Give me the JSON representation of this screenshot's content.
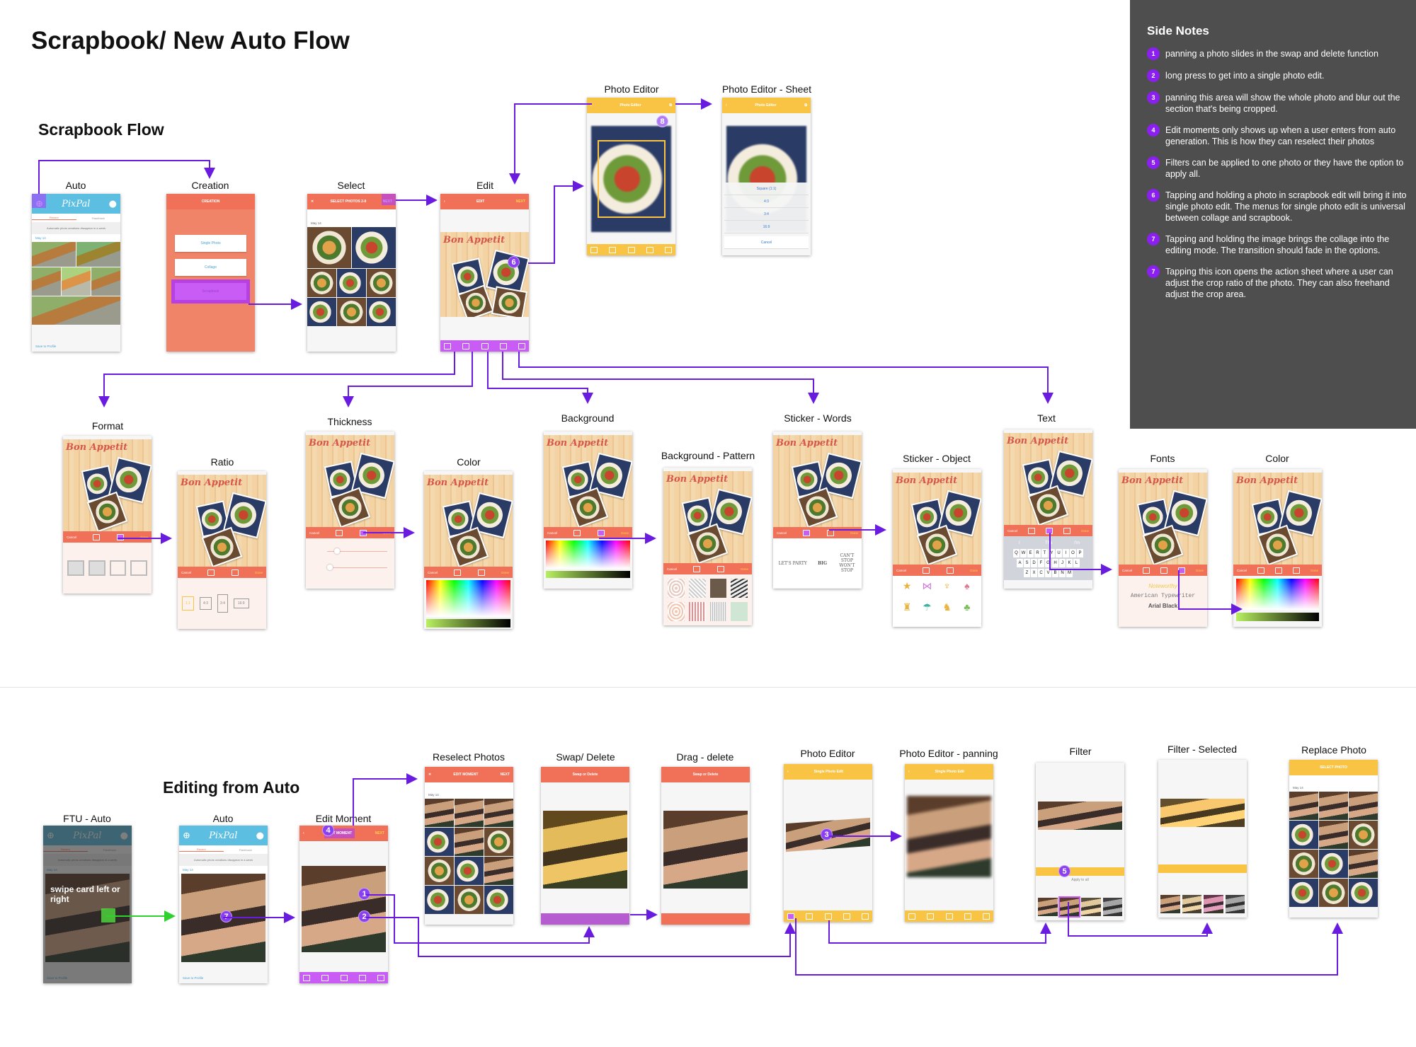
{
  "title": "Scrapbook/ New Auto Flow",
  "section_scrapbook": "Scrapbook Flow",
  "section_editing": "Editing from Auto",
  "side_notes": {
    "title": "Side Notes",
    "items": [
      {
        "num": "1",
        "text": "panning a photo slides in the swap and delete function"
      },
      {
        "num": "2",
        "text": "long press to get into a single photo edit."
      },
      {
        "num": "3",
        "text": "panning this area will show the whole photo and blur out the section that's being cropped."
      },
      {
        "num": "4",
        "text": "Edit moments only shows up when a user enters from auto generation. This is how they can reselect their photos"
      },
      {
        "num": "5",
        "text": "Filters can be applied to one photo or they have the option to apply all."
      },
      {
        "num": "6",
        "text": "Tapping and holding  a photo in scrapbook edit will bring it into single photo edit. The menus for single photo edit is universal between collage and scrapbook."
      },
      {
        "num": "7",
        "text": "Tapping and holding the image brings the collage into the editing mode. The transition should fade in the options."
      },
      {
        "num": "7",
        "text": "Tapping this icon opens the action sheet where a user can adjust the crop ratio of the photo. They can also freehand adjust the crop area."
      }
    ]
  },
  "common": {
    "app_name": "PixPal",
    "tab_recent": "Recent",
    "tab_flashback": "Flashback",
    "notice": "Automatic photo creations disappear in a week",
    "date": "May 14",
    "save": "Save to Profile",
    "cancel": "Cancel",
    "done": "Done",
    "next": "NEXT",
    "collage_title": "Bon Appetit"
  },
  "screens": {
    "auto": {
      "label": "Auto"
    },
    "creation": {
      "label": "Creation",
      "header": "CREATION",
      "options": [
        "Single Photo",
        "Collage",
        "Scrapbook"
      ]
    },
    "select": {
      "label": "Select",
      "header": "SELECT PHOTOS 2-8"
    },
    "edit": {
      "label": "Edit",
      "header": "EDIT"
    },
    "photo_editor": {
      "label": "Photo Editor",
      "header": "Photo Editor"
    },
    "photo_editor_sheet": {
      "label": "Photo Editor - Sheet",
      "header": "Photo Editor",
      "options": [
        "Square (1:1)",
        "4:3",
        "3:4",
        "16:9"
      ],
      "cancel": "Cancel"
    },
    "format": {
      "label": "Format"
    },
    "ratio": {
      "label": "Ratio",
      "options": [
        "1:1",
        "4:3",
        "3:4",
        "16:9"
      ]
    },
    "thickness": {
      "label": "Thickness"
    },
    "color": {
      "label": "Color"
    },
    "background": {
      "label": "Background"
    },
    "background_pattern": {
      "label": "Background - Pattern"
    },
    "sticker_words": {
      "label": "Sticker - Words",
      "words": [
        "LET'S PARTY",
        "BIG",
        "CAN'T STOP WON'T STOP"
      ]
    },
    "sticker_object": {
      "label": "Sticker - Object"
    },
    "text": {
      "label": "Text",
      "suggestions": [
        "I",
        "The",
        "I'm"
      ],
      "rows": [
        "QWERTYUIOP",
        "ASDFGHJKL",
        "ZXCVBNM"
      ]
    },
    "fonts": {
      "label": "Fonts",
      "options": [
        "Noteworthy",
        "American Typewriter",
        "Arial Black"
      ]
    },
    "color2": {
      "label": "Color"
    },
    "ftu_auto": {
      "label": "FTU - Auto",
      "hint": "swipe card left or right"
    },
    "auto2": {
      "label": "Auto"
    },
    "edit_moment": {
      "label": "Edit Moment",
      "header": "EDIT MOMENT"
    },
    "reselect": {
      "label": "Reselect Photos",
      "header": "EDIT MOMENT"
    },
    "swap_delete": {
      "label": "Swap/ Delete",
      "header": "Swap or Delete"
    },
    "drag_delete": {
      "label": "Drag - delete",
      "header": "Swap or Delete"
    },
    "photo_editor2": {
      "label": "Photo Editor",
      "header": "Single Photo Edit"
    },
    "photo_editor_panning": {
      "label": "Photo Editor - panning",
      "header": "Single Photo Edit"
    },
    "filter": {
      "label": "Filter",
      "apply_all": "Apply to all"
    },
    "filter_selected": {
      "label": "Filter - Selected"
    },
    "replace_photo": {
      "label": "Replace Photo",
      "header": "SELECT PHOTO"
    }
  },
  "badges": {
    "b8": "8",
    "b6": "6",
    "b4": "4",
    "b7": "7",
    "b1": "1",
    "b2": "2",
    "b3": "3",
    "b5": "5"
  },
  "colors": {
    "accent": "#f07158",
    "purple": "#6a1be0",
    "side_bg": "#4e4e4e",
    "yellow": "#f9c443",
    "blue": "#5cbfe2"
  }
}
